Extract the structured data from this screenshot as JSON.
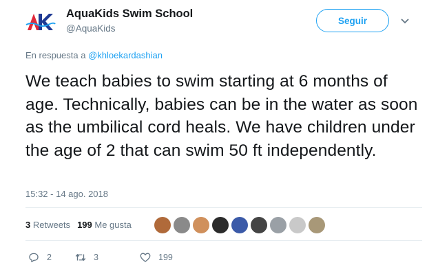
{
  "account": {
    "display_name": "AquaKids Swim School",
    "handle": "@AquaKids",
    "logo_text": "AK"
  },
  "header": {
    "follow_label": "Seguir",
    "caret_icon": "chevron-down-icon"
  },
  "reply": {
    "prefix": "En respuesta a",
    "mention": "@khloekardashian"
  },
  "tweet": {
    "text": "We teach babies to swim starting at 6 months of age. Technically, babies can be in the water as soon as the umbilical cord heals. We have children under the age of 2 that can swim 50 ft independently.",
    "timestamp": "15:32 - 14 ago. 2018"
  },
  "stats": {
    "retweets_count": "3",
    "retweets_label": "Retweets",
    "likes_count": "199",
    "likes_label": "Me gusta"
  },
  "liker_avatars": [
    {
      "name": "liker-avatar",
      "color": "#b06a3a"
    },
    {
      "name": "liker-avatar",
      "color": "#8a8a8a"
    },
    {
      "name": "liker-avatar",
      "color": "#d0905c"
    },
    {
      "name": "liker-avatar",
      "color": "#2b2b2b"
    },
    {
      "name": "liker-avatar",
      "color": "#3b5aa8"
    },
    {
      "name": "liker-avatar",
      "color": "#444444"
    },
    {
      "name": "liker-avatar",
      "color": "#9aa0a6"
    },
    {
      "name": "liker-avatar",
      "color": "#c9c9c9"
    },
    {
      "name": "liker-avatar",
      "color": "#a89878"
    }
  ],
  "actions": {
    "reply_count": "2",
    "retweet_count": "3",
    "like_count": "199"
  },
  "colors": {
    "accent": "#1da1f2",
    "text_secondary": "#657786",
    "logo_red": "#e0283a",
    "logo_blue": "#1f3a93"
  }
}
